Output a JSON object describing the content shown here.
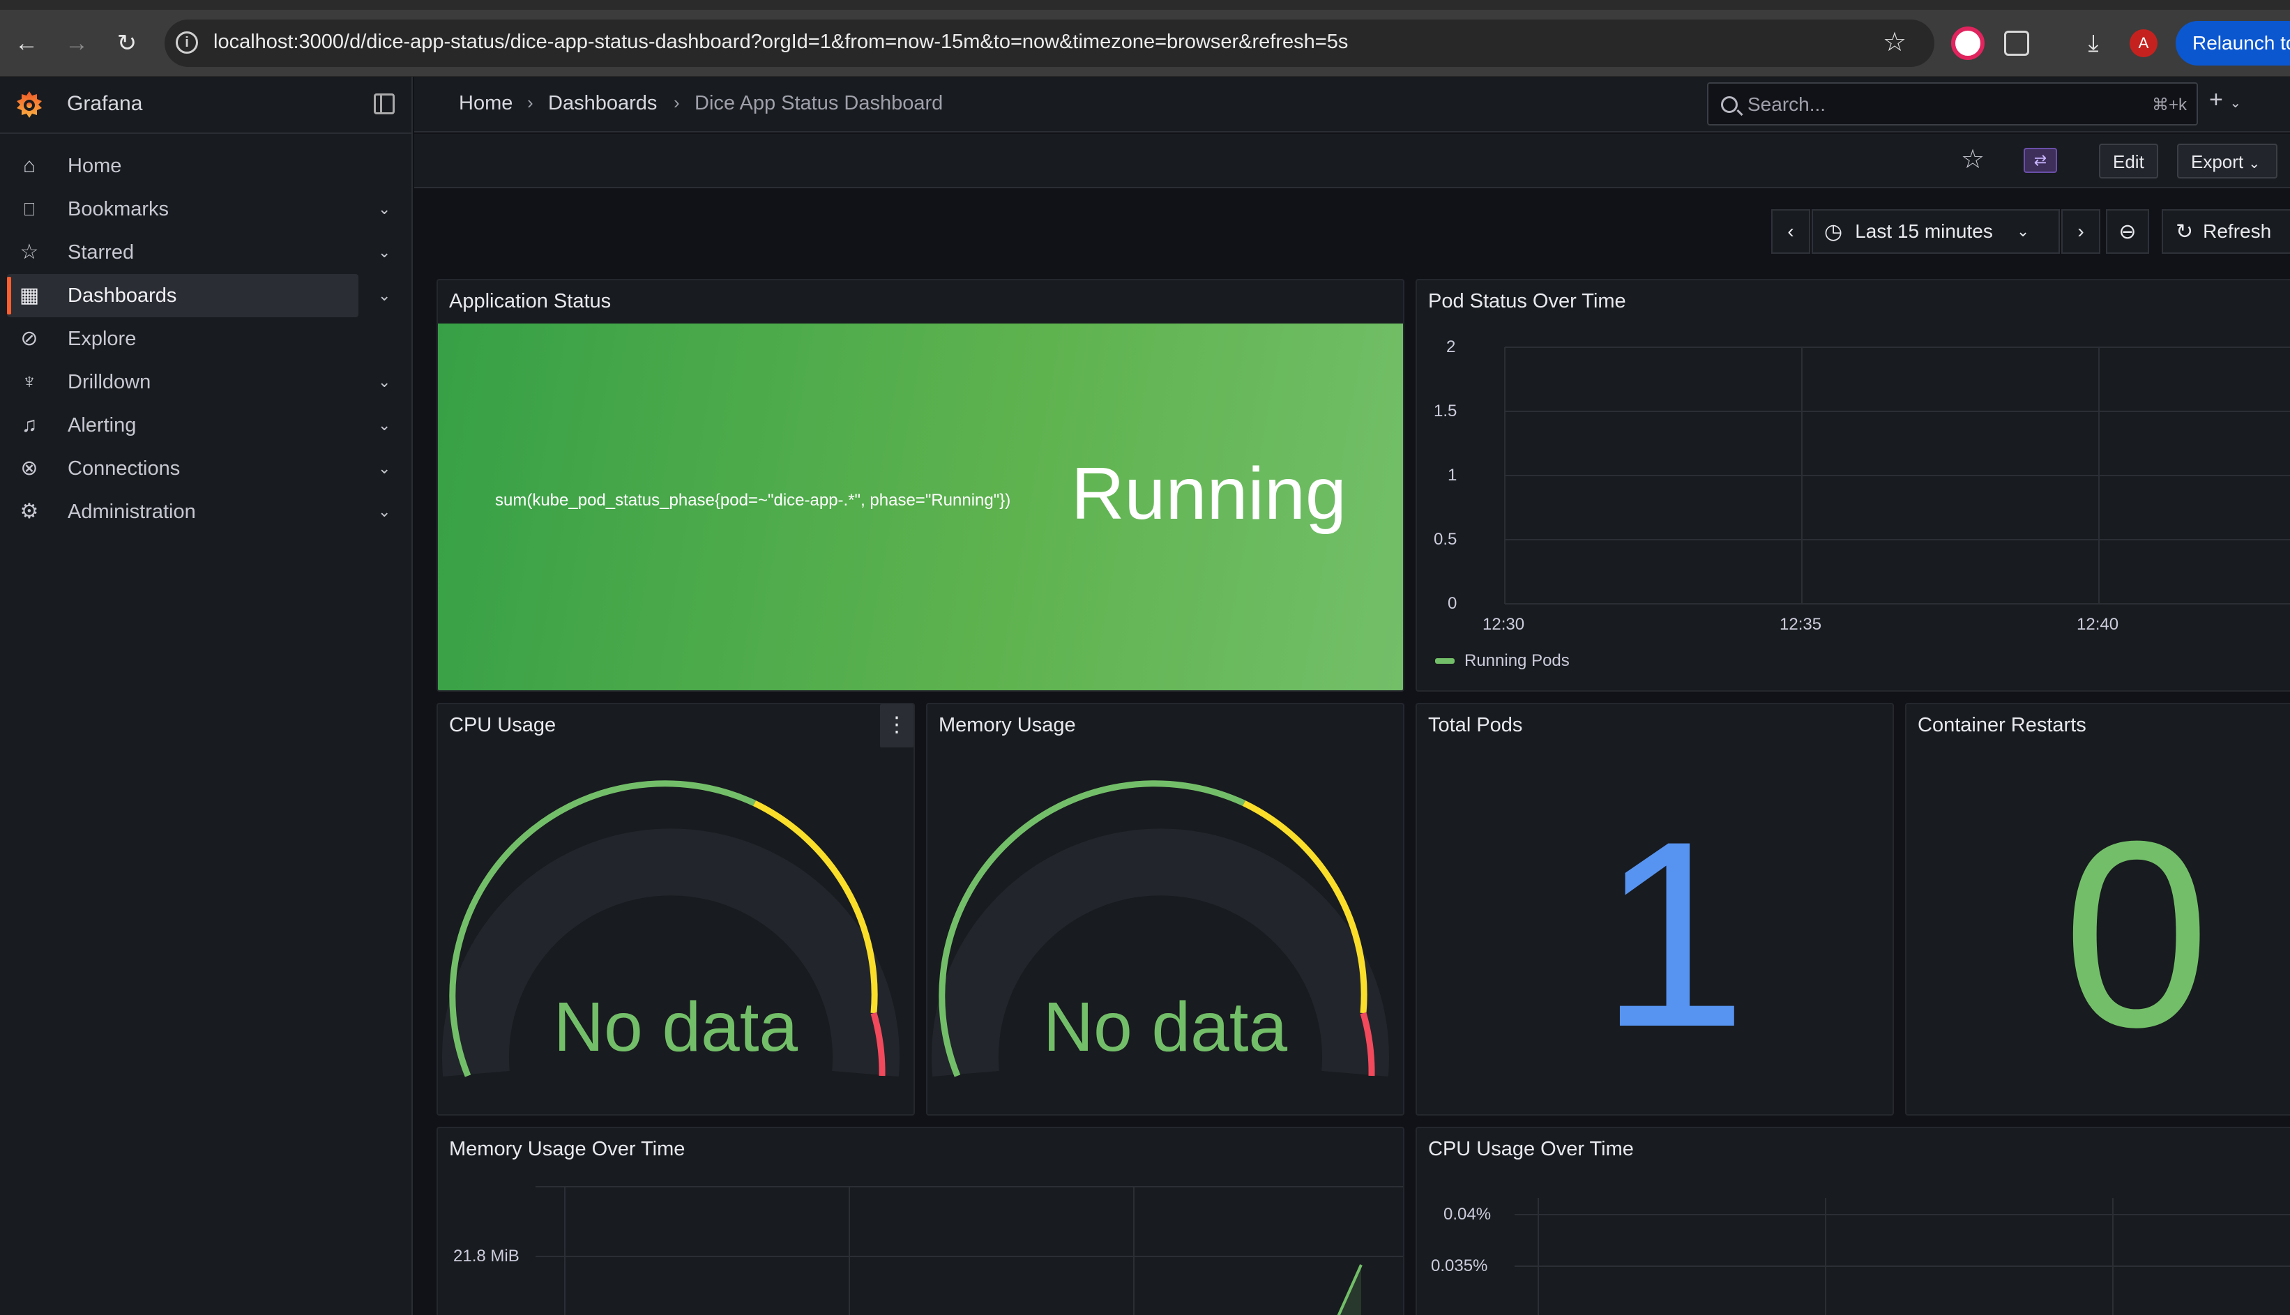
{
  "browser": {
    "url": "localhost:3000/d/dice-app-status/dice-app-status-dashboard?orgId=1&from=now-15m&to=now&timezone=browser&refresh=5s",
    "profile_initial": "A",
    "relaunch_label": "Relaunch to"
  },
  "sidebar": {
    "brand": "Grafana",
    "items": [
      {
        "label": "Home",
        "icon": "home-icon",
        "expandable": false
      },
      {
        "label": "Bookmarks",
        "icon": "bookmark-icon",
        "expandable": true
      },
      {
        "label": "Starred",
        "icon": "star-icon",
        "expandable": true
      },
      {
        "label": "Dashboards",
        "icon": "dashboards-grid-icon",
        "expandable": true,
        "active": true
      },
      {
        "label": "Explore",
        "icon": "compass-icon",
        "expandable": false
      },
      {
        "label": "Drilldown",
        "icon": "drilldown-icon",
        "expandable": true
      },
      {
        "label": "Alerting",
        "icon": "bell-icon",
        "expandable": true
      },
      {
        "label": "Connections",
        "icon": "plug-icon",
        "expandable": true
      },
      {
        "label": "Administration",
        "icon": "gear-icon",
        "expandable": true
      }
    ]
  },
  "topbar": {
    "breadcrumbs": [
      "Home",
      "Dashboards",
      "Dice App Status Dashboard"
    ],
    "search_placeholder": "Search...",
    "search_shortcut": "⌘+k"
  },
  "toolbar": {
    "edit_label": "Edit",
    "export_label": "Export"
  },
  "time": {
    "range_label": "Last 15 minutes",
    "refresh_label": "Refresh"
  },
  "panels": {
    "app_status": {
      "title": "Application Status",
      "query": "sum(kube_pod_status_phase{pod=~\"dice-app-.*\", phase=\"Running\"})",
      "value": "Running",
      "color": "#5fb34f"
    },
    "pod_status": {
      "title": "Pod Status Over Time",
      "y_ticks": [
        "2",
        "1.5",
        "1",
        "0.5",
        "0"
      ],
      "x_ticks": [
        "12:30",
        "12:35",
        "12:40"
      ],
      "legend": "Running Pods"
    },
    "cpu_usage": {
      "title": "CPU Usage",
      "value": "No data"
    },
    "memory_usage": {
      "title": "Memory Usage",
      "value": "No data"
    },
    "total_pods": {
      "title": "Total Pods",
      "value": "1",
      "color": "#5794f2"
    },
    "container_restarts": {
      "title": "Container Restarts",
      "value": "0",
      "color": "#73bf69"
    },
    "memory_over_time": {
      "title": "Memory Usage Over Time",
      "y_ticks": [
        "21.8 MiB"
      ]
    },
    "cpu_over_time": {
      "title": "CPU Usage Over Time",
      "y_ticks": [
        "0.04%",
        "0.035%"
      ]
    }
  },
  "chart_data": [
    {
      "type": "line",
      "title": "Pod Status Over Time",
      "x": [
        "12:30",
        "12:35",
        "12:40"
      ],
      "ylim": [
        0,
        2
      ],
      "series": [
        {
          "name": "Running Pods",
          "values": []
        }
      ],
      "grid": true,
      "legend": "bottom-left"
    },
    {
      "type": "line",
      "title": "Memory Usage Over Time",
      "ylabel": "",
      "y_ticks": [
        "21.8 MiB"
      ],
      "series": [
        {
          "values": []
        }
      ],
      "grid": true
    },
    {
      "type": "line",
      "title": "CPU Usage Over Time",
      "y_ticks": [
        "0.04%",
        "0.035%"
      ],
      "series": [],
      "grid": true
    }
  ]
}
